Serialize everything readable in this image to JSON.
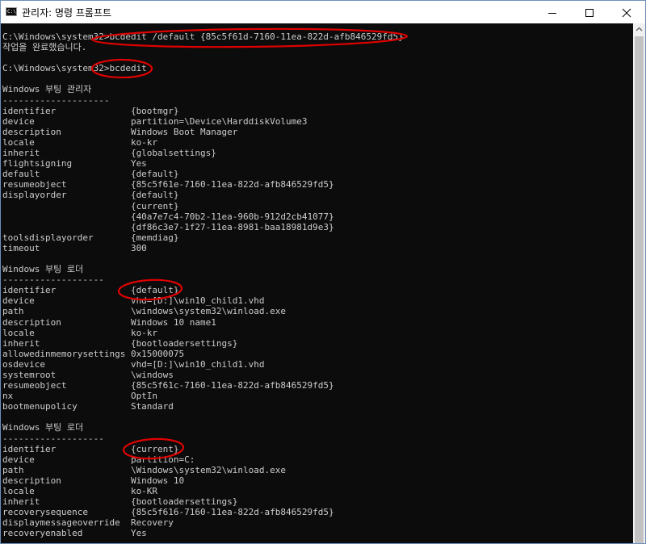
{
  "window": {
    "title": "관리자: 명령 프롬프트",
    "app_icon_text": "C:\\"
  },
  "console_lines": [
    "C:\\Windows\\system32>bcdedit /default {85c5f61d-7160-11ea-822d-afb846529fd5}",
    "작업을 완료했습니다.",
    "",
    "C:\\Windows\\system32>bcdedit",
    "",
    "Windows 부팅 관리자",
    "--------------------",
    "identifier              {bootmgr}",
    "device                  partition=\\Device\\HarddiskVolume3",
    "description             Windows Boot Manager",
    "locale                  ko-kr",
    "inherit                 {globalsettings}",
    "flightsigning           Yes",
    "default                 {default}",
    "resumeobject            {85c5f61e-7160-11ea-822d-afb846529fd5}",
    "displayorder            {default}",
    "                        {current}",
    "                        {40a7e7c4-70b2-11ea-960b-912d2cb41077}",
    "                        {df86c3e7-1f27-11ea-8981-baa18981d9e3}",
    "toolsdisplayorder       {memdiag}",
    "timeout                 300",
    "",
    "Windows 부팅 로더",
    "-------------------",
    "identifier              {default}",
    "device                  vhd=[D:]\\win10_child1.vhd",
    "path                    \\windows\\system32\\winload.exe",
    "description             Windows 10 name1",
    "locale                  ko-kr",
    "inherit                 {bootloadersettings}",
    "allowedinmemorysettings 0x15000075",
    "osdevice                vhd=[D:]\\win10_child1.vhd",
    "systemroot              \\windows",
    "resumeobject            {85c5f61c-7160-11ea-822d-afb846529fd5}",
    "nx                      OptIn",
    "bootmenupolicy          Standard",
    "",
    "Windows 부팅 로더",
    "-------------------",
    "identifier              {current}",
    "device                  partition=C:",
    "path                    \\Windows\\system32\\winload.exe",
    "description             Windows 10",
    "locale                  ko-KR",
    "inherit                 {bootloadersettings}",
    "recoverysequence        {85c5f616-7160-11ea-822d-afb846529fd5}",
    "displaymessageoverride  Recovery",
    "recoveryenabled         Yes"
  ],
  "colors": {
    "console_background": "#0c0c0c",
    "console_text": "#cccccc",
    "annotation": "#e00000",
    "titlebar": "#ffffff"
  },
  "icons": {
    "minimize": "minimize-icon",
    "maximize": "maximize-icon",
    "close": "close-icon",
    "scroll_up": "arrow-up-icon"
  }
}
